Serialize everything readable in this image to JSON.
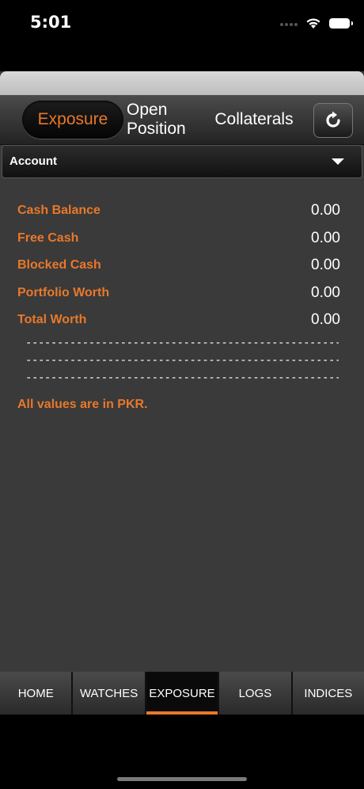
{
  "status": {
    "time": "5:01"
  },
  "toolbar": {
    "segments": [
      {
        "label": "Exposure"
      },
      {
        "label_line1": "Open",
        "label_line2": "Position"
      },
      {
        "label": "Collaterals"
      }
    ],
    "accent_color": "#e8782b"
  },
  "account": {
    "label": "Account"
  },
  "summary": {
    "rows": [
      {
        "label": "Cash Balance",
        "value": "0.00"
      },
      {
        "label": "Free Cash",
        "value": "0.00"
      },
      {
        "label": "Blocked Cash",
        "value": "0.00"
      },
      {
        "label": "Portfolio Worth",
        "value": "0.00"
      },
      {
        "label": "Total Worth",
        "value": "0.00"
      }
    ],
    "divider": "----------------------------------------------------------",
    "note": "All values are in PKR."
  },
  "tabs": [
    {
      "label": "HOME"
    },
    {
      "label": "WATCHES"
    },
    {
      "label": "EXPOSURE"
    },
    {
      "label": "LOGS"
    },
    {
      "label": "INDICES"
    }
  ]
}
